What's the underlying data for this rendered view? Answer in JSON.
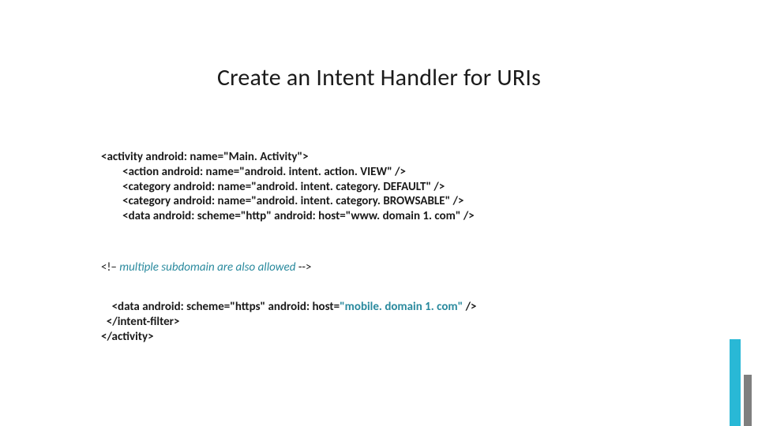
{
  "title": "Create an Intent Handler for URIs",
  "code1": {
    "l1": "<activity android: name=\"Main. Activity\">",
    "l2": "        <action android: name=\"android. intent. action. VIEW\" />",
    "l3": "        <category android: name=\"android. intent. category. DEFAULT\" />",
    "l4": "        <category android: name=\"android. intent. category. BROWSABLE\" />",
    "l5": "        <data android: scheme=\"http\" android: host=\"www. domain 1. com\" />"
  },
  "comment": {
    "prefix": "<!– ",
    "italic": "multiple subdomain are also allowed ",
    "suffix": "-->"
  },
  "code2": {
    "l1a": "    <data android: scheme=\"https\" android: host=",
    "l1b": "\"mobile. domain 1. com\"",
    "l1c": " />",
    "l2": "  </intent-filter>",
    "l3": "</activity>"
  }
}
